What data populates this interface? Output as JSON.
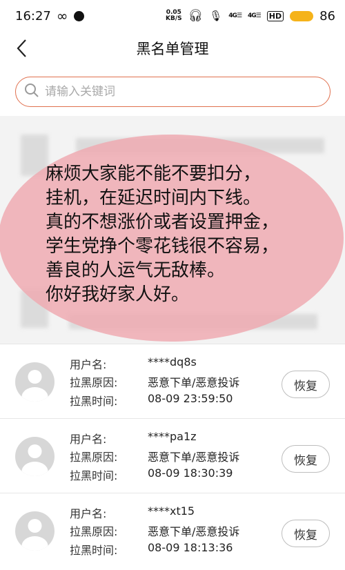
{
  "status_bar": {
    "time": "16:27",
    "speed_top": "0.05",
    "speed_bottom": "KB/S",
    "sig1": "4G",
    "sig2": "4G",
    "hd": "HD",
    "battery": "86"
  },
  "header": {
    "title": "黑名单管理"
  },
  "search": {
    "placeholder": "请输入关键词"
  },
  "overlay": {
    "lines": "麻烦大家能不能不要扣分，\n挂机，在延迟时间内下线。\n真的不想涨价或者设置押金，\n学生党挣个零花钱很不容易，\n善良的人运气无敌棒。\n你好我好家人好。"
  },
  "list": {
    "labels": {
      "username": "用户名:",
      "reason": "拉黑原因:",
      "time": "拉黑时间:"
    },
    "restore_label": "恢复",
    "items": [
      {
        "username": "****dq8s",
        "reason": "恶意下单/恶意投诉",
        "time": "08-09 23:59:50"
      },
      {
        "username": "****pa1z",
        "reason": "恶意下单/恶意投诉",
        "time": "08-09 18:30:39"
      },
      {
        "username": "****xt15",
        "reason": "恶意下单/恶意投诉",
        "time": "08-09 18:13:36"
      }
    ]
  },
  "colors": {
    "search_border": "#e0704e",
    "overlay": "#eeaab2",
    "battery": "#f5b31a"
  }
}
